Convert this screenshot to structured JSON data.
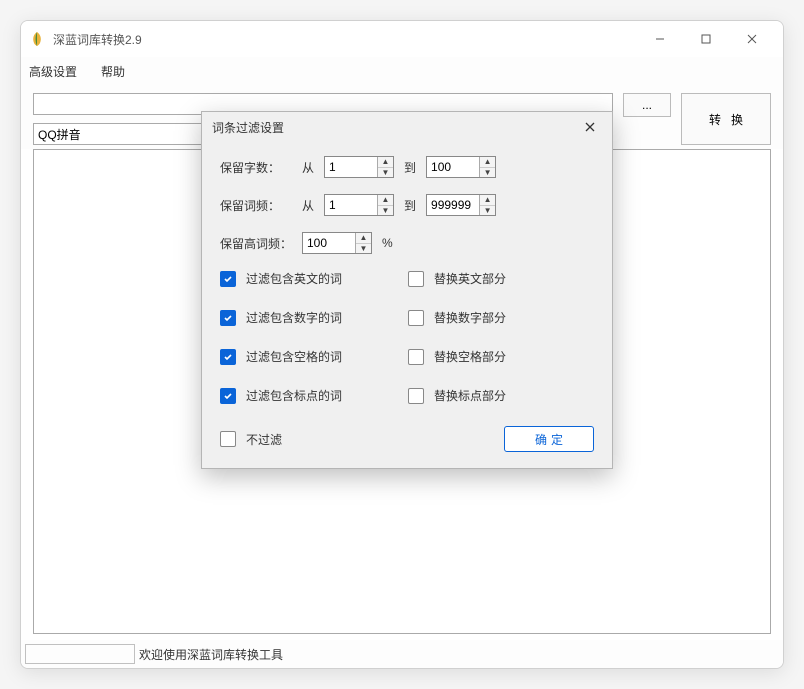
{
  "window": {
    "title": "深蓝词库转换2.9"
  },
  "menubar": {
    "advanced": "高级设置",
    "help": "帮助"
  },
  "toolbar": {
    "path_value": "",
    "browse_label": "...",
    "convert_label": "转换",
    "format_value": "QQ拼音"
  },
  "statusbar": {
    "welcome": "欢迎使用深蓝词库转换工具"
  },
  "dialog": {
    "title": "词条过滤设置",
    "char_count_label": "保留字数：",
    "freq_label": "保留词频：",
    "high_freq_label": "保留高词频：",
    "from_label": "从",
    "to_label": "到",
    "char_from": "1",
    "char_to": "100",
    "freq_from": "1",
    "freq_to": "999999",
    "high_freq_value": "100",
    "percent": "%",
    "filter_english": "过滤包含英文的词",
    "replace_english": "替换英文部分",
    "filter_digit": "过滤包含数字的词",
    "replace_digit": "替换数字部分",
    "filter_space": "过滤包含空格的词",
    "replace_space": "替换空格部分",
    "filter_punct": "过滤包含标点的词",
    "replace_punct": "替换标点部分",
    "no_filter": "不过滤",
    "ok": "确定"
  }
}
